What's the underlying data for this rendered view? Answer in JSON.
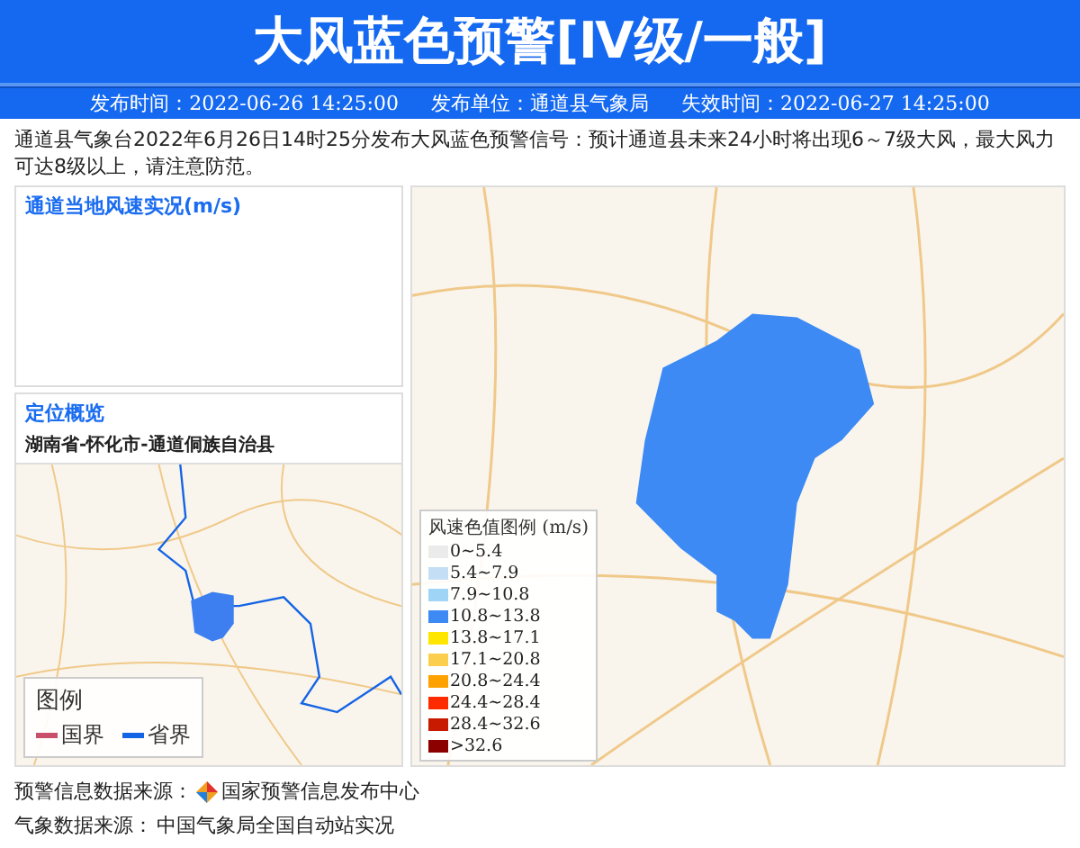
{
  "header": {
    "title": "大风蓝色预警[Ⅳ级/一般]",
    "publish_time": "发布时间：2022-06-26 14:25:00",
    "publisher": "发布单位：通道县气象局",
    "expire_time": "失效时间：2022-06-27 14:25:00"
  },
  "description": "通道县气象台2022年6月26日14时25分发布大风蓝色预警信号：预计通道县未来24小时将出现6～7级大风，最大风力可达8级以上，请注意防范。",
  "wind_panel": {
    "title": "通道当地风速实况(m/s)"
  },
  "location_panel": {
    "title": "定位概览",
    "region": "湖南省-怀化市-通道侗族自治县",
    "legend_title": "图例",
    "legend": [
      {
        "label": "国界",
        "color": "#c8506a"
      },
      {
        "label": "省界",
        "color": "#1464e6"
      }
    ]
  },
  "wind_legend": {
    "title": "风速色值图例 (m/s)",
    "items": [
      {
        "label": "0~5.4",
        "color": "#ebebeb"
      },
      {
        "label": "5.4~7.9",
        "color": "#c4dff5"
      },
      {
        "label": "7.9~10.8",
        "color": "#9fd4f7"
      },
      {
        "label": "10.8~13.8",
        "color": "#3d8af5"
      },
      {
        "label": "13.8~17.1",
        "color": "#ffe600"
      },
      {
        "label": "17.1~20.8",
        "color": "#fbcf4d"
      },
      {
        "label": "20.8~24.4",
        "color": "#ffa200"
      },
      {
        "label": "24.4~28.4",
        "color": "#ff2b00"
      },
      {
        "label": "28.4~32.6",
        "color": "#c81a00"
      },
      {
        "label": ">32.6",
        "color": "#8c0000"
      }
    ]
  },
  "sources": [
    {
      "label": "预警信息数据来源：",
      "value": "国家预警信息发布中心",
      "kind": "logo"
    },
    {
      "label": "气象数据来源：",
      "value": "中国气象局全国自动站实况",
      "kind": "plain"
    }
  ]
}
